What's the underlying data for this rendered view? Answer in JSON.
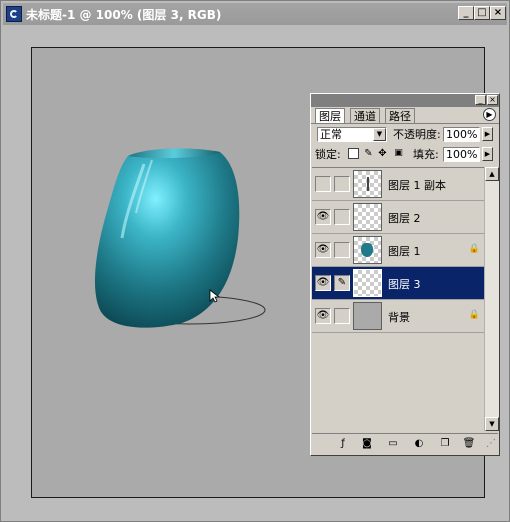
{
  "window": {
    "title": "未标题-1 @ 100% (图层 3, RGB)",
    "controls": {
      "minimize": "_",
      "maximize": "□",
      "close": "×"
    }
  },
  "layers_panel": {
    "tabs": [
      {
        "label": "图层",
        "active": true
      },
      {
        "label": "通道",
        "active": false
      },
      {
        "label": "路径",
        "active": false
      }
    ],
    "blend_mode": "正常",
    "opacity_label": "不透明度:",
    "opacity_value": "100%",
    "lock_label": "锁定:",
    "fill_label": "填充:",
    "fill_value": "100%",
    "layers": [
      {
        "name": "图层 1 副本",
        "visible": false,
        "selected": false,
        "locked": false,
        "thumb": "line"
      },
      {
        "name": "图层 2",
        "visible": true,
        "selected": false,
        "locked": false,
        "thumb": "transparent"
      },
      {
        "name": "图层 1",
        "visible": true,
        "selected": false,
        "locked": true,
        "thumb": "vase"
      },
      {
        "name": "图层 3",
        "visible": true,
        "selected": true,
        "locked": false,
        "thumb": "transparent"
      },
      {
        "name": "背景",
        "visible": true,
        "selected": false,
        "locked": true,
        "thumb": "grey"
      }
    ],
    "bottom_icons": [
      "layer-style-icon",
      "mask-icon",
      "new-set-icon",
      "adjustment-layer-icon",
      "new-layer-icon",
      "trash-icon"
    ]
  },
  "colors": {
    "vase_dark": "#0c4a55",
    "vase_mid": "#2a8c9c",
    "vase_light": "#7ff0ff",
    "selection": "#0a246a",
    "canvas": "#aaaaaa"
  }
}
